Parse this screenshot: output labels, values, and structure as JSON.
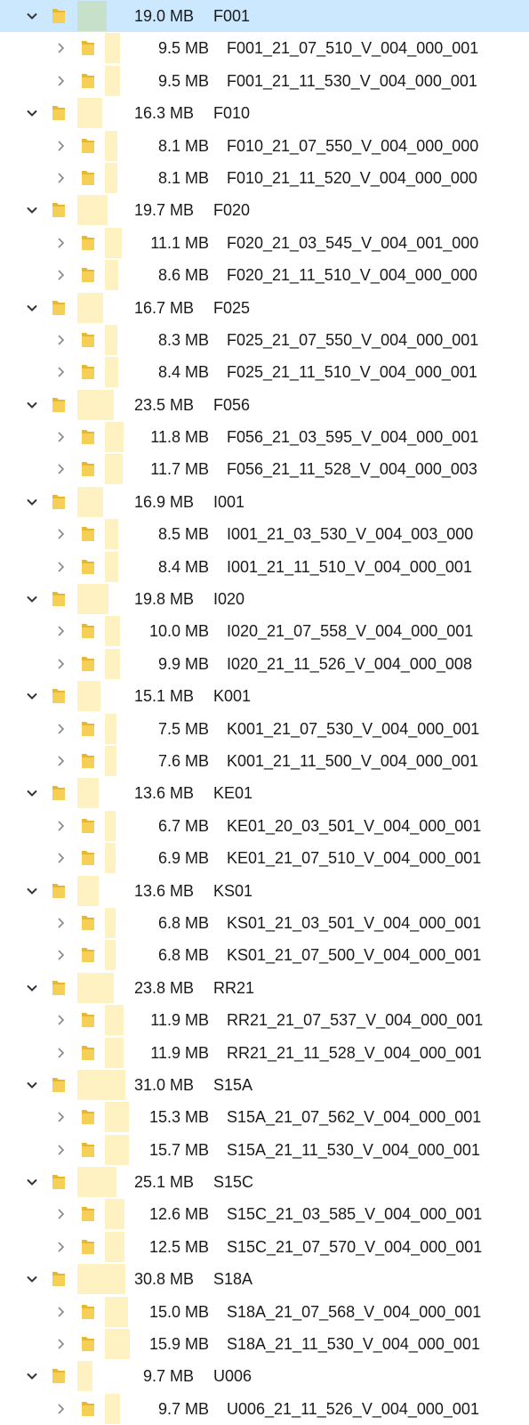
{
  "colors": {
    "selection": "#cce8ff",
    "size_bar": "#fff2c2",
    "selected_size_bar": "#c7e0c9",
    "folder": "#f4c542"
  },
  "groups": [
    {
      "size": "19.0 MB",
      "name": "F001",
      "share": 0.613,
      "selected": true,
      "children": [
        {
          "size": "9.5 MB",
          "name": "F001_21_07_510_V_004_000_001",
          "share": 0.306
        },
        {
          "size": "9.5 MB",
          "name": "F001_21_11_530_V_004_000_001",
          "share": 0.306
        }
      ]
    },
    {
      "size": "16.3 MB",
      "name": "F010",
      "share": 0.526,
      "children": [
        {
          "size": "8.1 MB",
          "name": "F010_21_07_550_V_004_000_000",
          "share": 0.261
        },
        {
          "size": "8.1 MB",
          "name": "F010_21_11_520_V_004_000_000",
          "share": 0.261
        }
      ]
    },
    {
      "size": "19.7 MB",
      "name": "F020",
      "share": 0.635,
      "children": [
        {
          "size": "11.1 MB",
          "name": "F020_21_03_545_V_004_001_000",
          "share": 0.358
        },
        {
          "size": "8.6 MB",
          "name": "F020_21_11_510_V_004_000_000",
          "share": 0.277
        }
      ]
    },
    {
      "size": "16.7 MB",
      "name": "F025",
      "share": 0.539,
      "children": [
        {
          "size": "8.3 MB",
          "name": "F025_21_07_550_V_004_000_001",
          "share": 0.268
        },
        {
          "size": "8.4 MB",
          "name": "F025_21_11_510_V_004_000_001",
          "share": 0.271
        }
      ]
    },
    {
      "size": "23.5 MB",
      "name": "F056",
      "share": 0.758,
      "children": [
        {
          "size": "11.8 MB",
          "name": "F056_21_03_595_V_004_000_001",
          "share": 0.381
        },
        {
          "size": "11.7 MB",
          "name": "F056_21_11_528_V_004_000_003",
          "share": 0.377
        }
      ]
    },
    {
      "size": "16.9 MB",
      "name": "I001",
      "share": 0.545,
      "children": [
        {
          "size": "8.5 MB",
          "name": "I001_21_03_530_V_004_003_000",
          "share": 0.274
        },
        {
          "size": "8.4 MB",
          "name": "I001_21_11_510_V_004_000_001",
          "share": 0.271
        }
      ]
    },
    {
      "size": "19.8 MB",
      "name": "I020",
      "share": 0.639,
      "children": [
        {
          "size": "10.0 MB",
          "name": "I020_21_07_558_V_004_000_001",
          "share": 0.323
        },
        {
          "size": "9.9 MB",
          "name": "I020_21_11_526_V_004_000_008",
          "share": 0.319
        }
      ]
    },
    {
      "size": "15.1 MB",
      "name": "K001",
      "share": 0.487,
      "children": [
        {
          "size": "7.5 MB",
          "name": "K001_21_07_530_V_004_000_001",
          "share": 0.242
        },
        {
          "size": "7.6 MB",
          "name": "K001_21_11_500_V_004_000_001",
          "share": 0.245
        }
      ]
    },
    {
      "size": "13.6 MB",
      "name": "KE01",
      "share": 0.439,
      "children": [
        {
          "size": "6.7 MB",
          "name": "KE01_20_03_501_V_004_000_001",
          "share": 0.216
        },
        {
          "size": "6.9 MB",
          "name": "KE01_21_07_510_V_004_000_001",
          "share": 0.223
        }
      ]
    },
    {
      "size": "13.6 MB",
      "name": "KS01",
      "share": 0.439,
      "children": [
        {
          "size": "6.8 MB",
          "name": "KS01_21_03_501_V_004_000_001",
          "share": 0.219
        },
        {
          "size": "6.8 MB",
          "name": "KS01_21_07_500_V_004_000_001",
          "share": 0.219
        }
      ]
    },
    {
      "size": "23.8 MB",
      "name": "RR21",
      "share": 0.768,
      "children": [
        {
          "size": "11.9 MB",
          "name": "RR21_21_07_537_V_004_000_001",
          "share": 0.384
        },
        {
          "size": "11.9 MB",
          "name": "RR21_21_11_528_V_004_000_001",
          "share": 0.384
        }
      ]
    },
    {
      "size": "31.0 MB",
      "name": "S15A",
      "share": 1.0,
      "children": [
        {
          "size": "15.3 MB",
          "name": "S15A_21_07_562_V_004_000_001",
          "share": 0.494
        },
        {
          "size": "15.7 MB",
          "name": "S15A_21_11_530_V_004_000_001",
          "share": 0.506
        }
      ]
    },
    {
      "size": "25.1 MB",
      "name": "S15C",
      "share": 0.81,
      "children": [
        {
          "size": "12.6 MB",
          "name": "S15C_21_03_585_V_004_000_001",
          "share": 0.406
        },
        {
          "size": "12.5 MB",
          "name": "S15C_21_07_570_V_004_000_001",
          "share": 0.403
        }
      ]
    },
    {
      "size": "30.8 MB",
      "name": "S18A",
      "share": 0.994,
      "children": [
        {
          "size": "15.0 MB",
          "name": "S18A_21_07_568_V_004_000_001",
          "share": 0.484
        },
        {
          "size": "15.9 MB",
          "name": "S18A_21_11_530_V_004_000_001",
          "share": 0.513
        }
      ]
    },
    {
      "size": "9.7 MB",
      "name": "U006",
      "share": 0.313,
      "children": [
        {
          "size": "9.7 MB",
          "name": "U006_21_11_526_V_004_000_001",
          "share": 0.313
        }
      ]
    }
  ]
}
